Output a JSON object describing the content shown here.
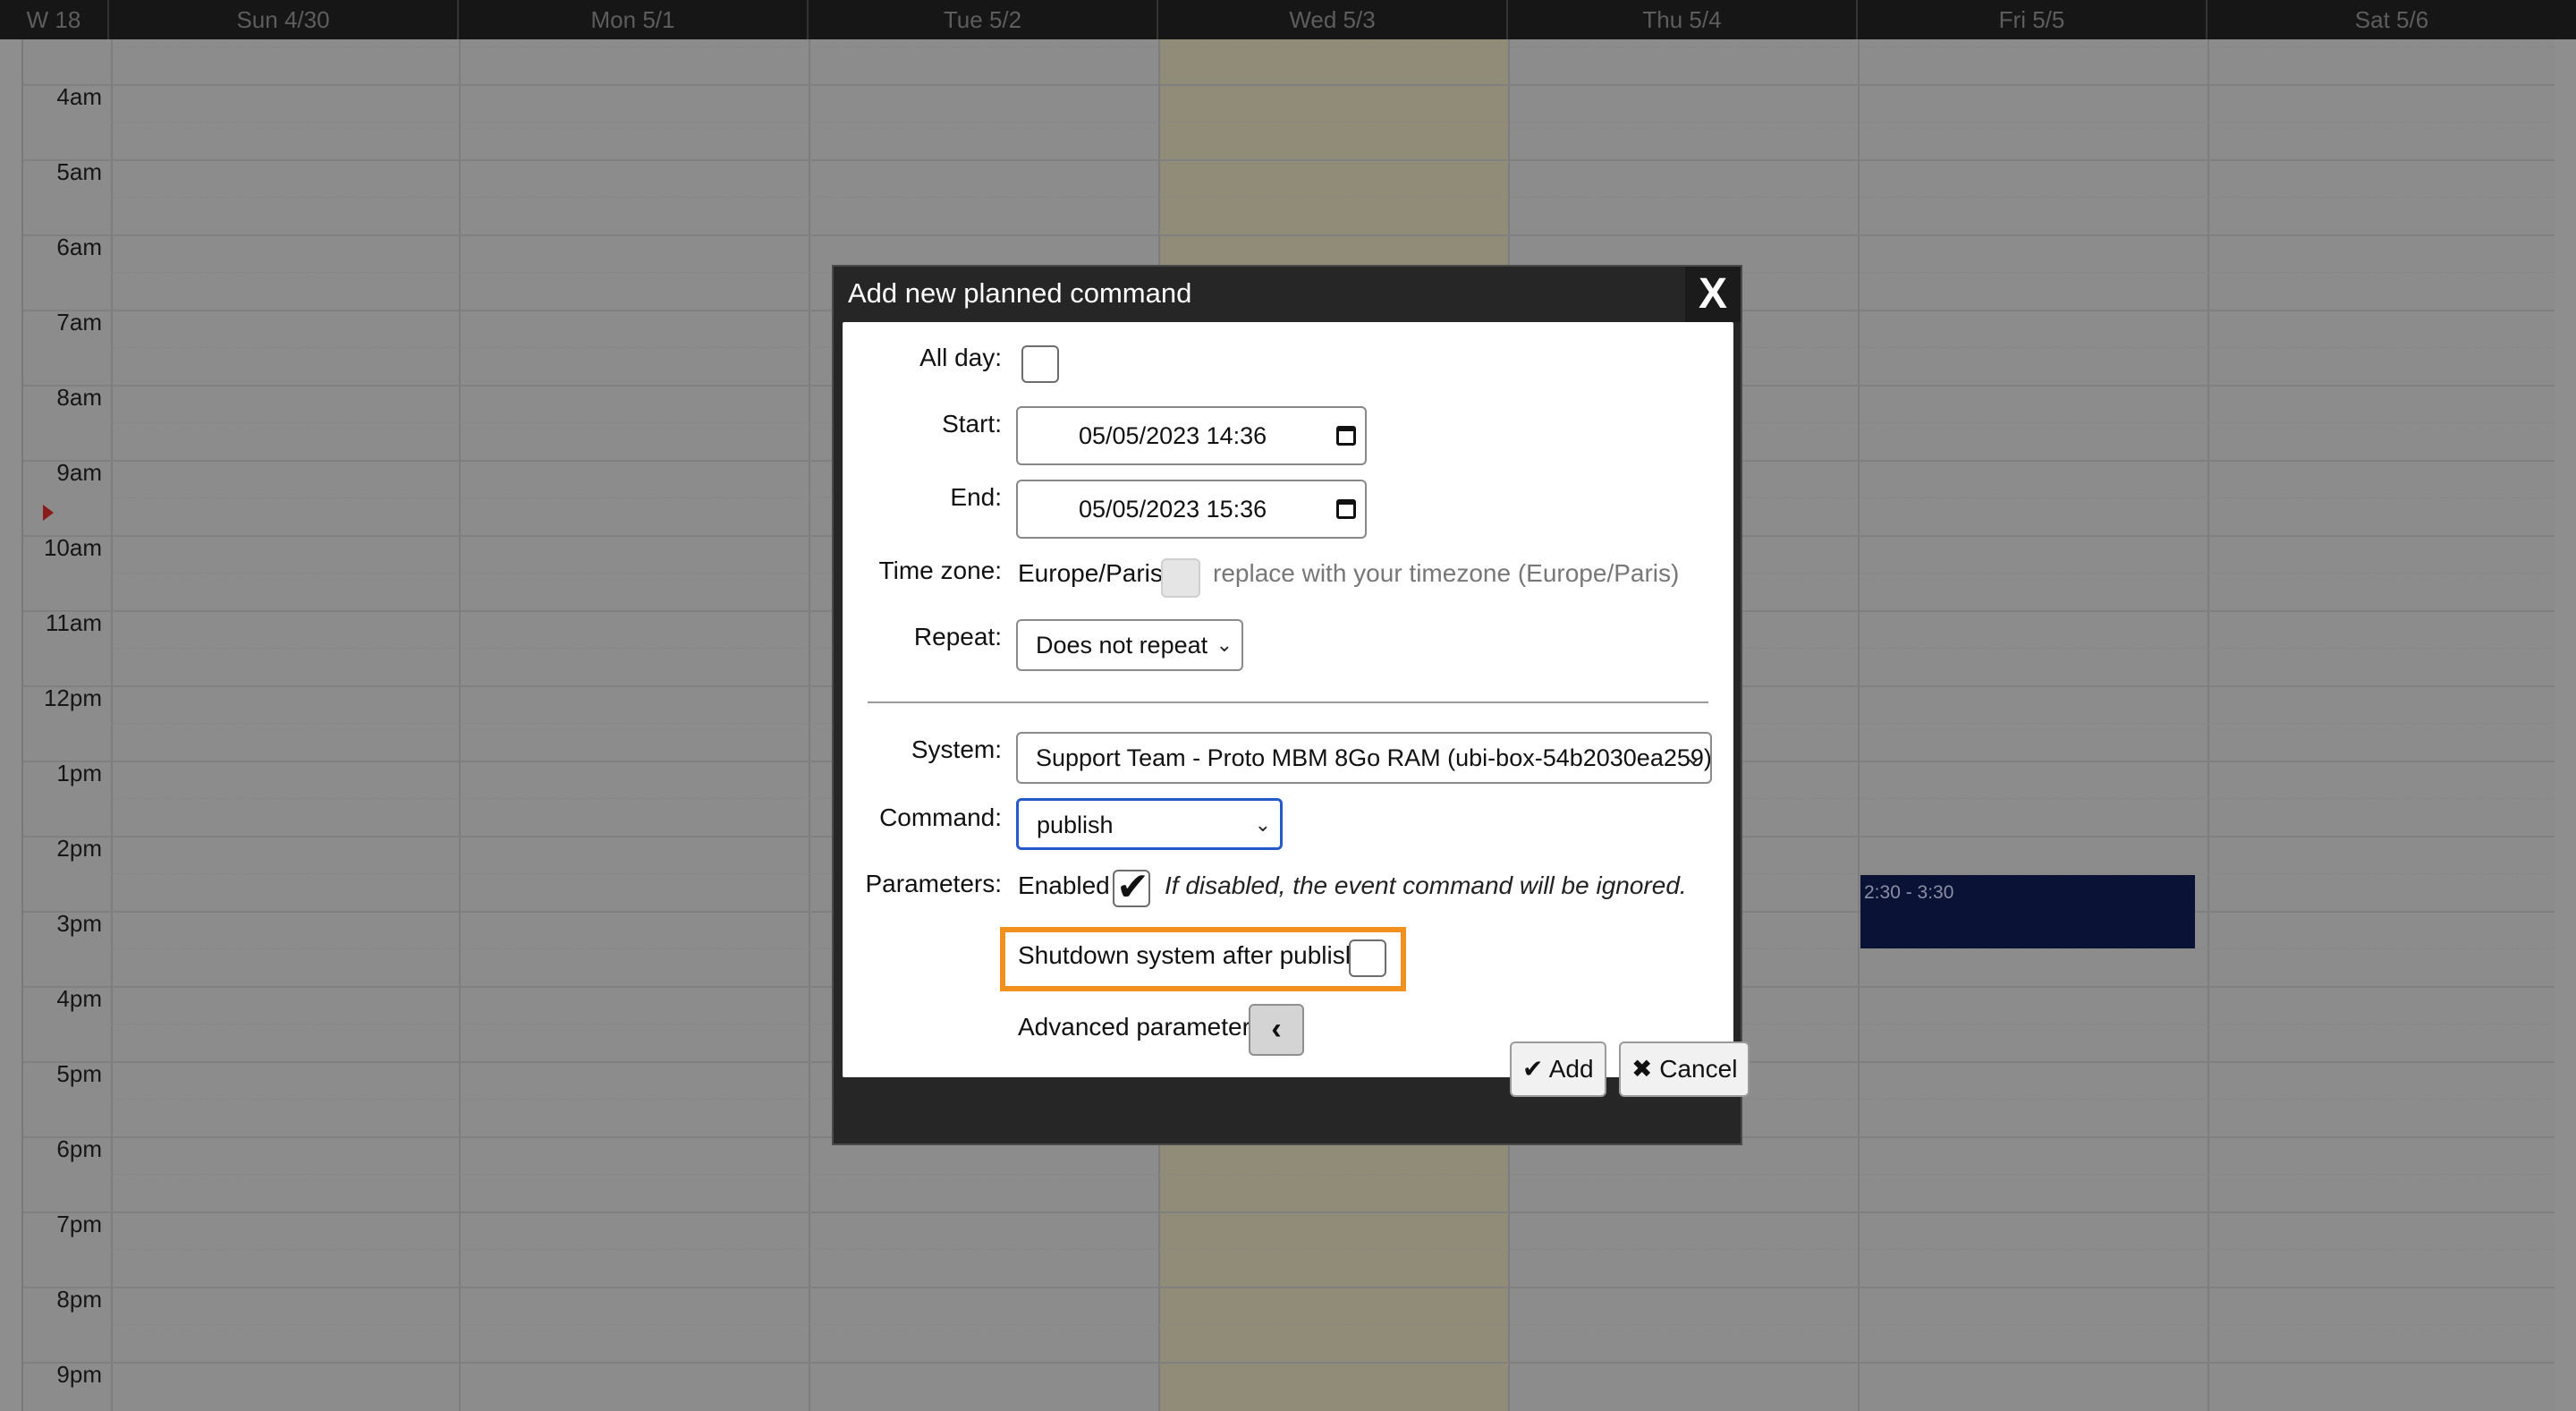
{
  "calendar": {
    "week_label": "W 18",
    "days": [
      "Sun 4/30",
      "Mon 5/1",
      "Tue 5/2",
      "Wed 5/3",
      "Thu 5/4",
      "Fri 5/5",
      "Sat 5/6"
    ],
    "hours": [
      "4am",
      "5am",
      "6am",
      "7am",
      "8am",
      "9am",
      "10am",
      "11am",
      "12pm",
      "1pm",
      "2pm",
      "3pm",
      "4pm",
      "5pm",
      "6pm",
      "7pm",
      "8pm",
      "9pm"
    ],
    "event": {
      "label": "2:30 - 3:30",
      "color": "#0a1236"
    }
  },
  "dialog": {
    "title": "Add new planned command",
    "close_label": "X",
    "all_day_label": "All day:",
    "all_day_checked": false,
    "start_label": "Start:",
    "start_value": "05/05/2023 14:36",
    "end_label": "End:",
    "end_value": "05/05/2023 15:36",
    "timezone_label": "Time zone:",
    "timezone_value": "Europe/Paris",
    "timezone_replace_hint": "replace with your timezone (Europe/Paris)",
    "repeat_label": "Repeat:",
    "repeat_value": "Does not repeat",
    "system_label": "System:",
    "system_value": "Support Team - Proto MBM 8Go RAM (ubi-box-54b2030ea259)",
    "command_label": "Command:",
    "command_value": "publish",
    "parameters_label": "Parameters:",
    "enabled_label": "Enabled",
    "enabled_checked": true,
    "enabled_hint": "If disabled, the event command will be ignored.",
    "shutdown_label": "Shutdown system after publish",
    "shutdown_checked": false,
    "advanced_label": "Advanced parameters",
    "add_label": "Add",
    "cancel_label": "Cancel",
    "highlight_color": "#f2901d"
  }
}
